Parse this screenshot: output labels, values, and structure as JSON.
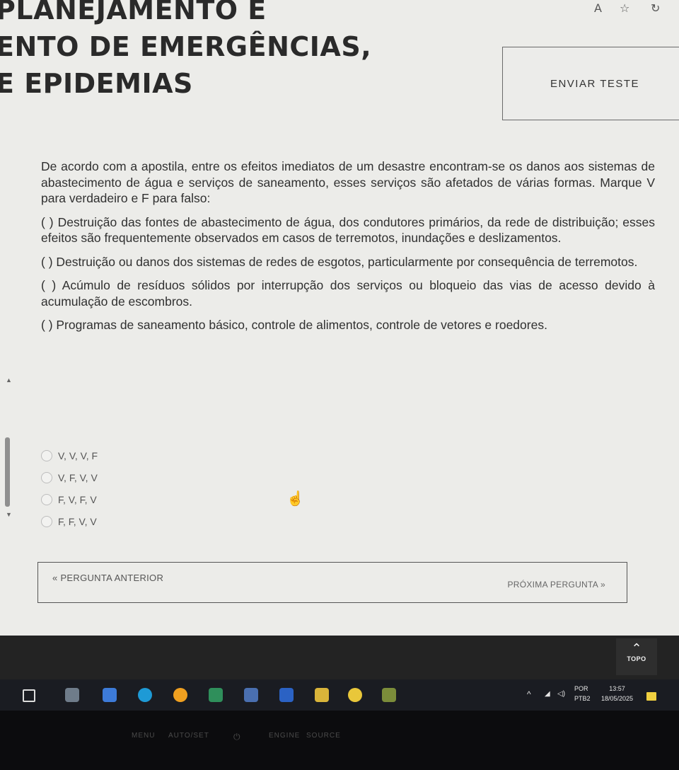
{
  "header": {
    "title_lines": [
      "PLANEJAMENTO E",
      "ENTO DE EMERGÊNCIAS,",
      "E EPIDEMIAS"
    ],
    "send_button_label": "ENVIAR TESTE"
  },
  "question": {
    "intro_text": "De acordo com a apostila, entre os efeitos imediatos de um desastre encontram-se os danos aos sistemas de abastecimento de água e serviços de saneamento, esses serviços são afetados de várias formas. Marque V para verdadeiro e F para falso:",
    "statements": [
      "(     ) Destruição das fontes de abastecimento de água, dos condutores primários, da rede de distribuição; esses efeitos são frequentemente observados em casos de terremotos, inundações e deslizamentos.",
      "(   ) Destruição ou danos dos sistemas de redes de esgotos, particularmente por consequência de terremotos.",
      "(     ) Acúmulo de resíduos sólidos por interrupção dos serviços ou bloqueio das vias de acesso devido à acumulação de escombros.",
      "(   ) Programas de saneamento básico, controle de alimentos, controle de vetores e roedores."
    ]
  },
  "options": [
    "V, V, V, F",
    "V, F, V, V",
    "F, V, F, V",
    "F, F, V, V"
  ],
  "navigation": {
    "previous_label": "« PERGUNTA ANTERIOR",
    "next_label": "PRÓXIMA PERGUNTA »"
  },
  "footer": {
    "top_label": "TOPO"
  },
  "taskbar": {
    "language": "POR",
    "keyboard": "PTB2",
    "time": "13:57",
    "date": "18/05/2025"
  },
  "monitor": {
    "buttons": [
      "MENU",
      "AUTO/SET",
      "ENGINE",
      "SOURCE"
    ]
  }
}
